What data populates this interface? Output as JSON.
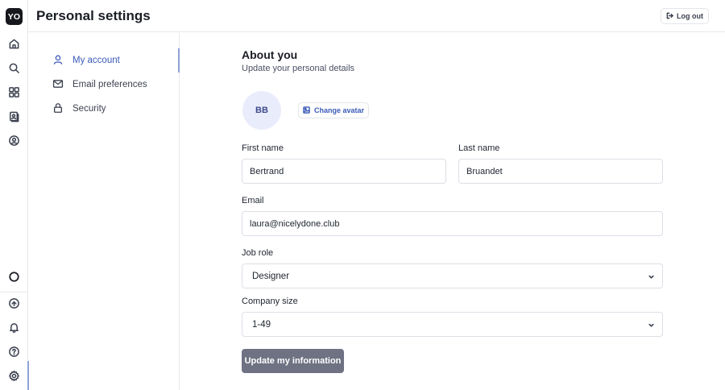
{
  "app": {
    "logo_text": "YO"
  },
  "rail": {
    "items": [
      {
        "icon": "home-icon"
      },
      {
        "icon": "search-icon"
      },
      {
        "icon": "grid-icon"
      },
      {
        "icon": "document-user-icon"
      },
      {
        "icon": "users-icon"
      }
    ],
    "bottom_items": [
      {
        "icon": "circle-status-icon"
      },
      {
        "icon": "upgrade-icon"
      },
      {
        "icon": "bell-icon"
      },
      {
        "icon": "help-icon"
      },
      {
        "icon": "gear-icon"
      }
    ]
  },
  "header": {
    "title": "Personal settings",
    "logout_label": "Log out"
  },
  "settings_nav": {
    "items": [
      {
        "label": "My account",
        "icon": "user-icon",
        "active": true
      },
      {
        "label": "Email preferences",
        "icon": "mail-icon",
        "active": false
      },
      {
        "label": "Security",
        "icon": "lock-icon",
        "active": false
      }
    ]
  },
  "about": {
    "title": "About you",
    "subtitle": "Update your personal details",
    "avatar_initials": "BB",
    "change_avatar_label": "Change avatar"
  },
  "form": {
    "first_name_label": "First name",
    "first_name_value": "Bertrand",
    "last_name_label": "Last name",
    "last_name_value": "Bruandet",
    "email_label": "Email",
    "email_value": "laura@nicelydone.club",
    "job_role_label": "Job role",
    "job_role_value": "Designer",
    "company_size_label": "Company size",
    "company_size_value": "1-49",
    "submit_label": "Update my information"
  },
  "colors": {
    "accent": "#3a5bb8",
    "button_bg": "#6e7282",
    "avatar_bg": "#e9ecfb"
  }
}
